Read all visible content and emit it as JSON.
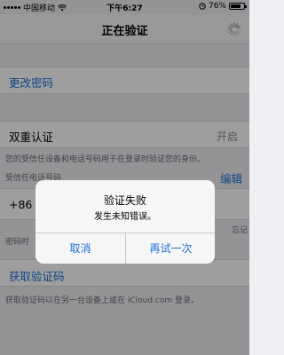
{
  "status_bar": {
    "carrier": "中国移动",
    "time": "下午6:27",
    "battery_percent": "76%",
    "battery_level": 0.76
  },
  "nav": {
    "title": "正在验证"
  },
  "change_password": {
    "label": "更改密码"
  },
  "two_factor": {
    "label": "双重认证",
    "value": "开启",
    "description": "您的受信任设备和电话号码用于在登录时验证您的身份。"
  },
  "trusted_phone": {
    "header": "受信任电话号码",
    "edit_label": "编辑",
    "number_prefix": "+86",
    "side_fragment_1": "忘记",
    "side_fragment_2": "密码时",
    "left_fragment": "密码时"
  },
  "get_code": {
    "label": "获取验证码",
    "description": "获取验证码以在另一台设备上或在 iCloud.com 登录。"
  },
  "alert": {
    "title": "验证失败",
    "message": "发生未知错误。",
    "cancel_label": "取消",
    "retry_label": "再试一次"
  },
  "colors": {
    "link": "#1e73d8",
    "background": "#efeff4"
  }
}
